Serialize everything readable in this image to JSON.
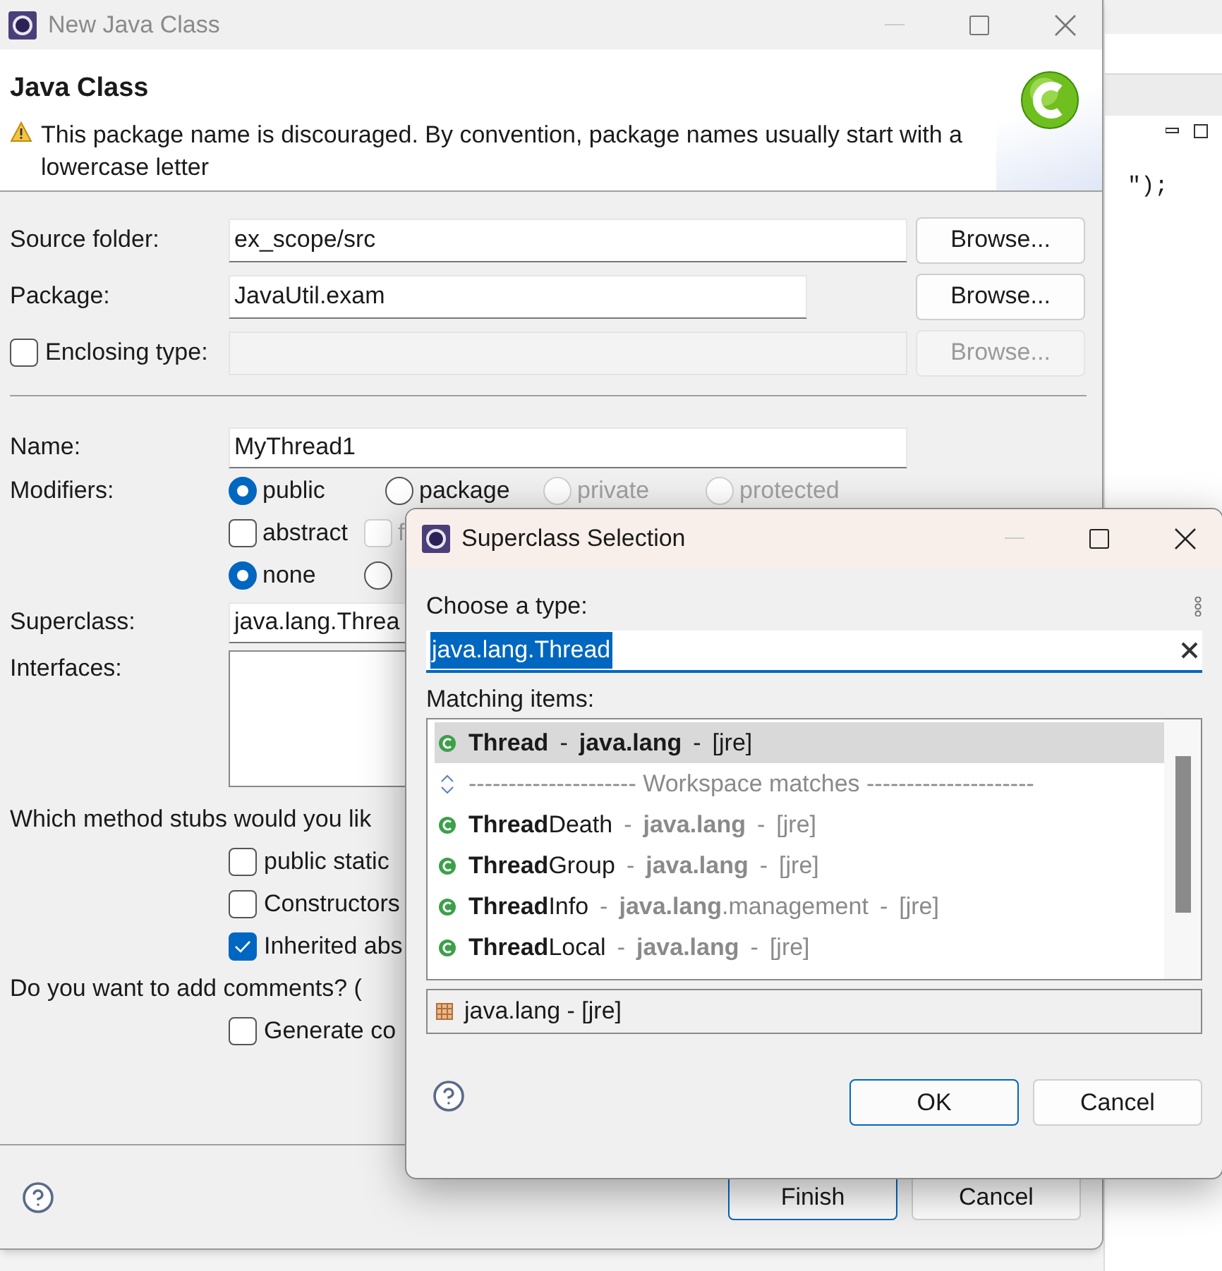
{
  "editor": {
    "code": "\");"
  },
  "main_window": {
    "title": "New Java Class",
    "header": {
      "title": "Java Class",
      "warning": "This package name is discouraged. By convention, package names usually start with a lowercase letter"
    },
    "fields": [
      {
        "label": "Source folder:",
        "value": "ex_scope/src",
        "button": "Browse...",
        "disabled": false,
        "kind": "text"
      },
      {
        "label": "Package:",
        "value": "JavaUtil.exam",
        "button": "Browse...",
        "disabled": false,
        "kind": "text"
      },
      {
        "label": "Enclosing type:",
        "button": "Browse...",
        "disabled": true,
        "checked": false,
        "kind": "check"
      }
    ],
    "name": {
      "label": "Name:",
      "value": "MyThread1"
    },
    "modifiers": {
      "label": "Modifiers:",
      "rows": [
        [
          {
            "kind": "radio",
            "label": "public",
            "selected": true,
            "disabled": false
          },
          {
            "kind": "radio",
            "label": "package",
            "selected": false,
            "disabled": false
          },
          {
            "kind": "radio",
            "label": "private",
            "selected": false,
            "disabled": true
          },
          {
            "kind": "radio",
            "label": "protected",
            "selected": false,
            "disabled": true
          }
        ],
        [
          {
            "kind": "checkbox",
            "label": "abstract",
            "checked": false,
            "disabled": false
          },
          {
            "kind": "checkbox",
            "label": "f",
            "checked": false,
            "disabled": true
          }
        ],
        [
          {
            "kind": "radio",
            "label": "none",
            "selected": true,
            "disabled": false
          },
          {
            "kind": "radio",
            "selected": false,
            "disabled": false
          }
        ]
      ]
    },
    "superclass": {
      "label": "Superclass:",
      "value": "java.lang.Threa"
    },
    "interfaces": {
      "label": "Interfaces:"
    },
    "stubs": {
      "question": "Which method stubs would you lik",
      "options": [
        {
          "label": "public static",
          "checked": false
        },
        {
          "label": "Constructors",
          "checked": false
        },
        {
          "label": "Inherited abs",
          "checked": true
        }
      ]
    },
    "comments": {
      "question": "Do you want to add comments? (",
      "options": [
        {
          "label": "Generate co",
          "checked": false
        }
      ]
    },
    "buttons": [
      {
        "label": "Finish",
        "default": true
      },
      {
        "label": "Cancel",
        "default": false
      }
    ]
  },
  "dialog": {
    "title": "Superclass Selection",
    "prompt": "Choose a type:",
    "search": {
      "value": "java.lang.Thread"
    },
    "list_label": "Matching items:",
    "items": [
      {
        "kind": "type",
        "selected": true,
        "parts": [
          {
            "text": "**Thread**",
            "dim": false
          },
          {
            "text": "-",
            "dim": false
          },
          {
            "text": "**java.lang**",
            "dim": false
          },
          {
            "text": "-",
            "dim": false
          },
          {
            "text": "[jre]",
            "dim": false
          }
        ]
      },
      {
        "kind": "separator",
        "selected": false,
        "parts": [
          {
            "text": "--------------------- Workspace matches ---------------------",
            "dim": true
          }
        ]
      },
      {
        "kind": "type",
        "selected": false,
        "parts": [
          {
            "text": "**Thread**Death",
            "dim": false
          },
          {
            "text": "-",
            "dim": true
          },
          {
            "text": "**java.lang**",
            "dim": true
          },
          {
            "text": "-",
            "dim": true
          },
          {
            "text": "[jre]",
            "dim": true
          }
        ]
      },
      {
        "kind": "type",
        "selected": false,
        "parts": [
          {
            "text": "**Thread**Group",
            "dim": false
          },
          {
            "text": "-",
            "dim": true
          },
          {
            "text": "**java.lang**",
            "dim": true
          },
          {
            "text": "-",
            "dim": true
          },
          {
            "text": "[jre]",
            "dim": true
          }
        ]
      },
      {
        "kind": "type",
        "selected": false,
        "parts": [
          {
            "text": "**Thread**Info",
            "dim": false
          },
          {
            "text": "-",
            "dim": true
          },
          {
            "text": "**java.lang**.management",
            "dim": true
          },
          {
            "text": "-",
            "dim": true
          },
          {
            "text": "[jre]",
            "dim": true
          }
        ]
      },
      {
        "kind": "type",
        "selected": false,
        "parts": [
          {
            "text": "**Thread**Local",
            "dim": false
          },
          {
            "text": "-",
            "dim": true
          },
          {
            "text": "**java.lang**",
            "dim": true
          },
          {
            "text": "-",
            "dim": true
          },
          {
            "text": "[jre]",
            "dim": true
          }
        ]
      }
    ],
    "status": "java.lang - [jre]",
    "buttons": [
      {
        "label": "OK",
        "default": true
      },
      {
        "label": "Cancel",
        "default": false
      }
    ]
  }
}
